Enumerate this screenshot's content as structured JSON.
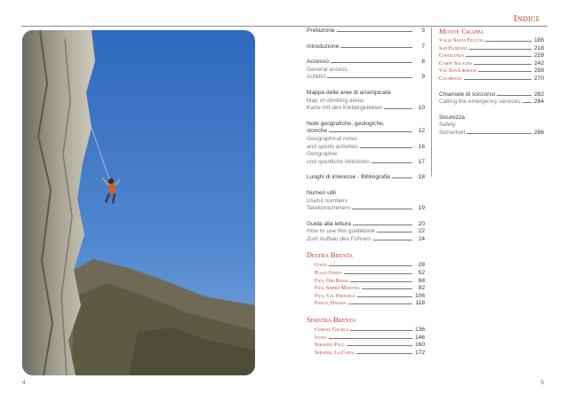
{
  "header": {
    "title": "Indice"
  },
  "pages": {
    "left": "4",
    "right": "5"
  },
  "toc_left": [
    {
      "lines": [
        "Prefazione"
      ],
      "num": "3"
    },
    {
      "lines": [
        "Introduzione"
      ],
      "num": "7"
    },
    {
      "lines": [
        "Accesso",
        "General access",
        "Anfahrt"
      ],
      "nums": [
        "8",
        "9"
      ]
    },
    {
      "lines": [
        "Mappa delle aree di arrampicata",
        "Map of climbing areas",
        "Karte mit den Klettergebieten"
      ],
      "num": "10"
    },
    {
      "lines": [
        "Note geografiche, geologiche,",
        "storiche",
        "Geographical notes",
        "and sports activities",
        "Geographie",
        "und sportliche Aktivisten"
      ],
      "nums": [
        "12",
        "16",
        "17"
      ]
    },
    {
      "lines": [
        "Luoghi di interesse - Bibliografia"
      ],
      "num": "18"
    },
    {
      "lines": [
        "Numeri utili",
        "Useful numbers",
        "Telefonnummern"
      ],
      "num": "19"
    },
    {
      "lines": [
        "Guida alla lettura",
        "How to use this guidebook",
        "Zum Aufbau des Führers"
      ],
      "nums": [
        "20",
        "22",
        "24"
      ]
    }
  ],
  "destra_brenta": {
    "title": "Destra Brenta",
    "items": [
      {
        "label": "Costa",
        "num": "28"
      },
      {
        "label": "Plaza Gerda",
        "num": "52"
      },
      {
        "label": "Fiza, Ori-Biasia",
        "num": "68"
      },
      {
        "label": "Fiza, Sierra Maestra",
        "num": "92"
      },
      {
        "label": "Fiza, Val Frenzela",
        "num": "106"
      },
      {
        "label": "Enego, Havana",
        "num": "118"
      }
    ]
  },
  "sinistra_brenta": {
    "title": "Sinistra Brenta",
    "items": [
      {
        "label": "Cismon, Giusela",
        "num": "136"
      },
      {
        "label": "Ivono",
        "num": "146"
      },
      {
        "label": "Serafini, Palù",
        "num": "160"
      },
      {
        "label": "Serafini, La Curva",
        "num": "172"
      }
    ]
  },
  "monte_grappa": {
    "title": "Monte Grappa",
    "items": [
      {
        "label": "Valle Santa Felicita",
        "num": "188"
      },
      {
        "label": "San Floriano",
        "num": "218"
      },
      {
        "label": "Costalunga",
        "num": "228"
      },
      {
        "label": "Campo Solagna",
        "num": "242"
      },
      {
        "label": "Val San Liberale",
        "num": "258"
      },
      {
        "label": "Colmirano",
        "num": "270"
      }
    ]
  },
  "emergency": {
    "lines": [
      "Chiamate di soccorso",
      "Calling the emergency services"
    ],
    "nums": [
      "282",
      "284"
    ]
  },
  "safety": {
    "lines": [
      "Sicurezza",
      "Safety",
      "Sicherheit"
    ],
    "num": "286"
  },
  "colors": {
    "accent": "#c03a2b",
    "sky": "#3f76c4",
    "rock": "#8a8679"
  }
}
